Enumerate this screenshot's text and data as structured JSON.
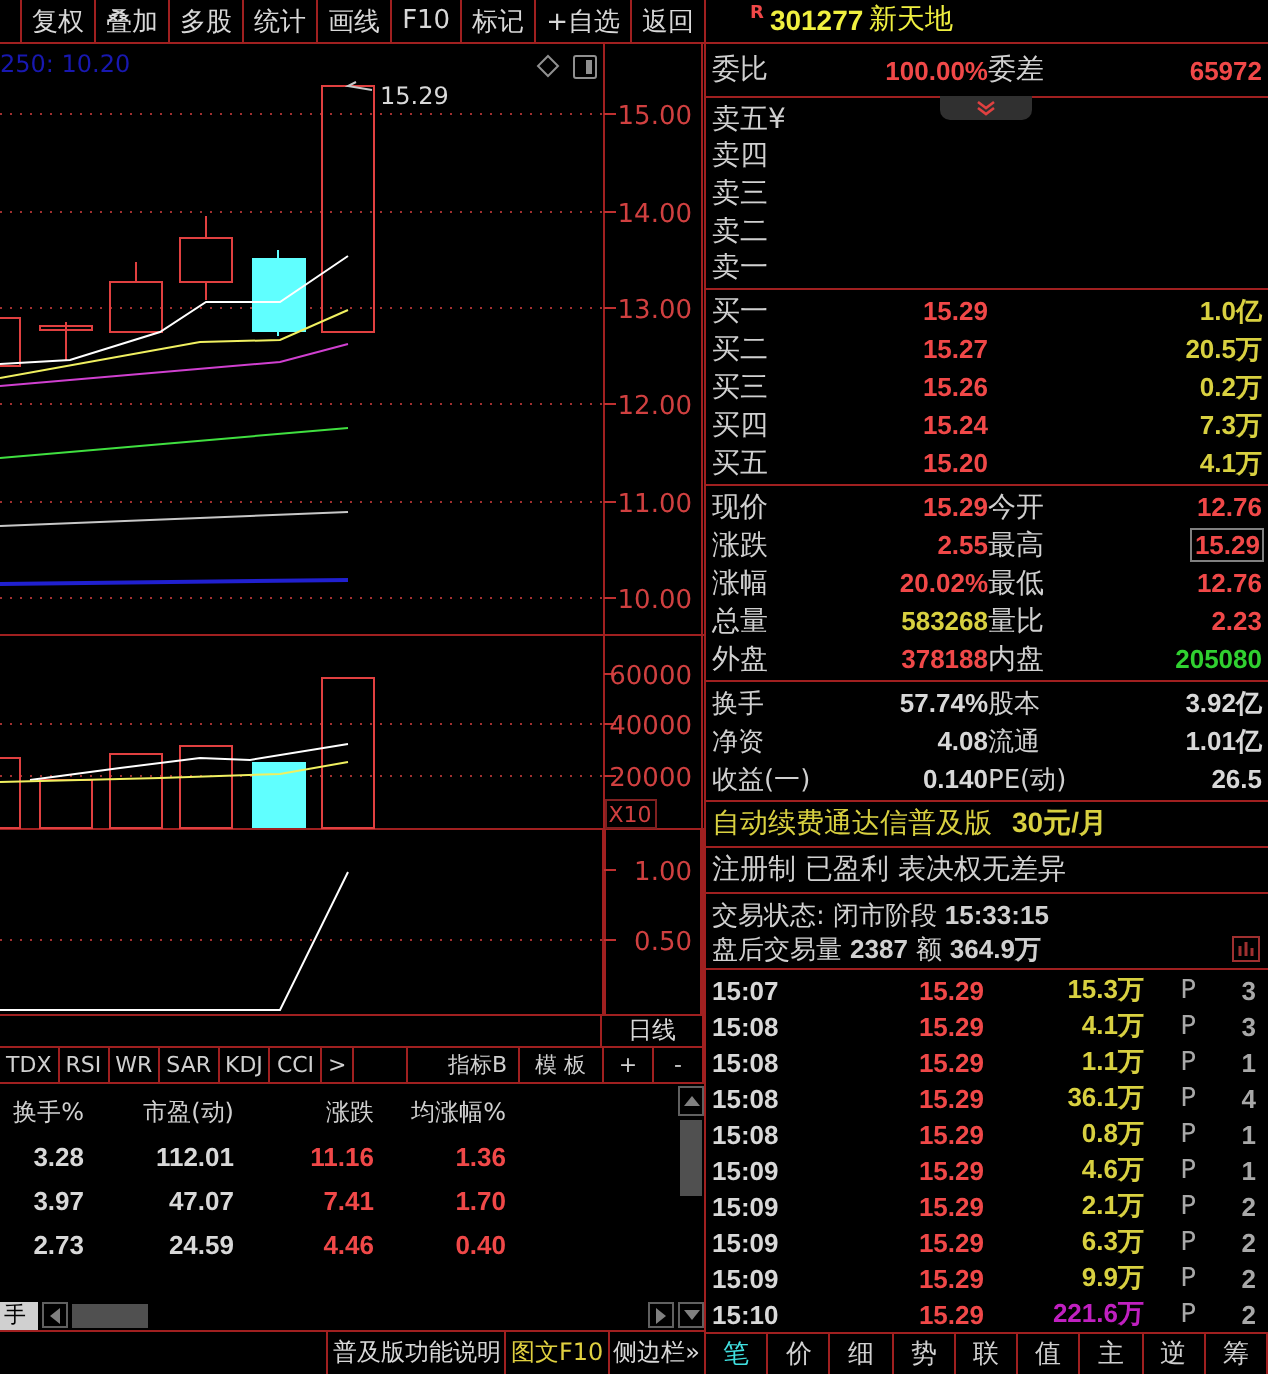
{
  "toolbar": [
    "复权",
    "叠加",
    "多股",
    "统计",
    "画线",
    "F10",
    "标记",
    "+自选",
    "返回"
  ],
  "price_chart": {
    "legend": "250: 10.20",
    "last_price_label": "15.29",
    "y_axis_labels": [
      "15.00",
      "14.00",
      "13.00",
      "12.00",
      "11.00",
      "10.00"
    ]
  },
  "volume_chart": {
    "y_axis_labels": [
      "60000",
      "40000",
      "20000"
    ],
    "scale_label": "X10"
  },
  "indicator_chart": {
    "y_axis_labels": [
      "1.00",
      "0.50"
    ]
  },
  "period_label": "日线",
  "indicator_tabs": [
    "TDX",
    "RSI",
    "WR",
    "SAR",
    "KDJ",
    "CCI",
    ">"
  ],
  "indicator_b": "指标B",
  "template_button": "模 板",
  "zoom_buttons": [
    "+",
    "-"
  ],
  "table": {
    "columns": [
      "换手%",
      "市盈(动)",
      "涨跌",
      "均涨幅%"
    ],
    "rows": [
      [
        "3.28",
        "112.01",
        "11.16",
        "1.36"
      ],
      [
        "3.97",
        "47.07",
        "7.41",
        "1.70"
      ],
      [
        "2.73",
        "24.59",
        "4.46",
        "0.40"
      ]
    ]
  },
  "sheet_tab": "手",
  "status_bar": [
    {
      "label": "普及版功能说明",
      "highlighted": false
    },
    {
      "label": "图文F10",
      "highlighted": true
    },
    {
      "label": "侧边栏»",
      "highlighted": false
    }
  ],
  "stock": {
    "badge": "R",
    "code": "301277",
    "name": "新天地"
  },
  "order_ratio": {
    "label": "委比",
    "value": "100.00%",
    "diff_label": "委差",
    "diff_value": "65972"
  },
  "sell_orders": [
    {
      "label": "卖五",
      "marker": "¥"
    },
    {
      "label": "卖四"
    },
    {
      "label": "卖三"
    },
    {
      "label": "卖二"
    },
    {
      "label": "卖一"
    }
  ],
  "buy_orders": [
    {
      "label": "买一",
      "price": "15.29",
      "volume": "1.0亿"
    },
    {
      "label": "买二",
      "price": "15.27",
      "volume": "20.5万"
    },
    {
      "label": "买三",
      "price": "15.26",
      "volume": "0.2万"
    },
    {
      "label": "买四",
      "price": "15.24",
      "volume": "7.3万"
    },
    {
      "label": "买五",
      "price": "15.20",
      "volume": "4.1万"
    }
  ],
  "quote_stats": [
    {
      "label": "现价",
      "value": "15.29",
      "color": "#f04848",
      "boxed": false
    },
    {
      "label": "今开",
      "value": "12.76",
      "color": "#f04848",
      "boxed": false
    },
    {
      "label": "涨跌",
      "value": "2.55",
      "color": "#f04848",
      "boxed": false
    },
    {
      "label": "最高",
      "value": "15.29",
      "color": "#f04848",
      "boxed": true
    },
    {
      "label": "涨幅",
      "value": "20.02%",
      "color": "#f04848",
      "boxed": false
    },
    {
      "label": "最低",
      "value": "12.76",
      "color": "#f04848",
      "boxed": false
    },
    {
      "label": "总量",
      "value": "583268",
      "color": "#d8d040",
      "boxed": false
    },
    {
      "label": "量比",
      "value": "2.23",
      "color": "#f04848",
      "boxed": false
    },
    {
      "label": "外盘",
      "value": "378188",
      "color": "#f04848",
      "boxed": false
    },
    {
      "label": "内盘",
      "value": "205080",
      "color": "#30d030",
      "boxed": false
    }
  ],
  "fundamentals": [
    {
      "label": "换手",
      "value": "57.74%"
    },
    {
      "label": "股本",
      "value": "3.92亿"
    },
    {
      "label": "净资",
      "value": "4.08"
    },
    {
      "label": "流通",
      "value": "1.01亿"
    },
    {
      "label": "收益(一)",
      "value": "0.140"
    },
    {
      "label": "PE(动)",
      "value": "26.5"
    }
  ],
  "promo": {
    "text": "自动续费通达信普及版",
    "price": "30元/月"
  },
  "tags_line": "注册制 已盈利 表决权无差异",
  "trade_status": {
    "label": "交易状态:",
    "value": "闭市阶段",
    "time": "15:33:15"
  },
  "after_hours": {
    "label": "盘后交易量",
    "volume": "2387",
    "amount_label": "额",
    "amount": "364.9万"
  },
  "trades": [
    {
      "time": "15:07",
      "price": "15.29",
      "volume": "15.3万",
      "flag": "P",
      "count": "3",
      "color": "#d8d040"
    },
    {
      "time": "15:08",
      "price": "15.29",
      "volume": "4.1万",
      "flag": "P",
      "count": "3",
      "color": "#d8d040"
    },
    {
      "time": "15:08",
      "price": "15.29",
      "volume": "1.1万",
      "flag": "P",
      "count": "1",
      "color": "#d8d040"
    },
    {
      "time": "15:08",
      "price": "15.29",
      "volume": "36.1万",
      "flag": "P",
      "count": "4",
      "color": "#d8d040"
    },
    {
      "time": "15:08",
      "price": "15.29",
      "volume": "0.8万",
      "flag": "P",
      "count": "1",
      "color": "#d8d040"
    },
    {
      "time": "15:09",
      "price": "15.29",
      "volume": "4.6万",
      "flag": "P",
      "count": "1",
      "color": "#d8d040"
    },
    {
      "time": "15:09",
      "price": "15.29",
      "volume": "2.1万",
      "flag": "P",
      "count": "2",
      "color": "#d8d040"
    },
    {
      "time": "15:09",
      "price": "15.29",
      "volume": "6.3万",
      "flag": "P",
      "count": "2",
      "color": "#d8d040"
    },
    {
      "time": "15:09",
      "price": "15.29",
      "volume": "9.9万",
      "flag": "P",
      "count": "2",
      "color": "#d8d040"
    },
    {
      "time": "15:10",
      "price": "15.29",
      "volume": "221.6万",
      "flag": "P",
      "count": "2",
      "color": "#c020c0"
    }
  ],
  "bottom_tabs": [
    {
      "label": "笔",
      "selected": true
    },
    {
      "label": "价",
      "selected": false
    },
    {
      "label": "细",
      "selected": false
    },
    {
      "label": "势",
      "selected": false
    },
    {
      "label": "联",
      "selected": false
    },
    {
      "label": "值",
      "selected": false
    },
    {
      "label": "主",
      "selected": false
    },
    {
      "label": "逆",
      "selected": false
    },
    {
      "label": "筹",
      "selected": false
    }
  ]
}
